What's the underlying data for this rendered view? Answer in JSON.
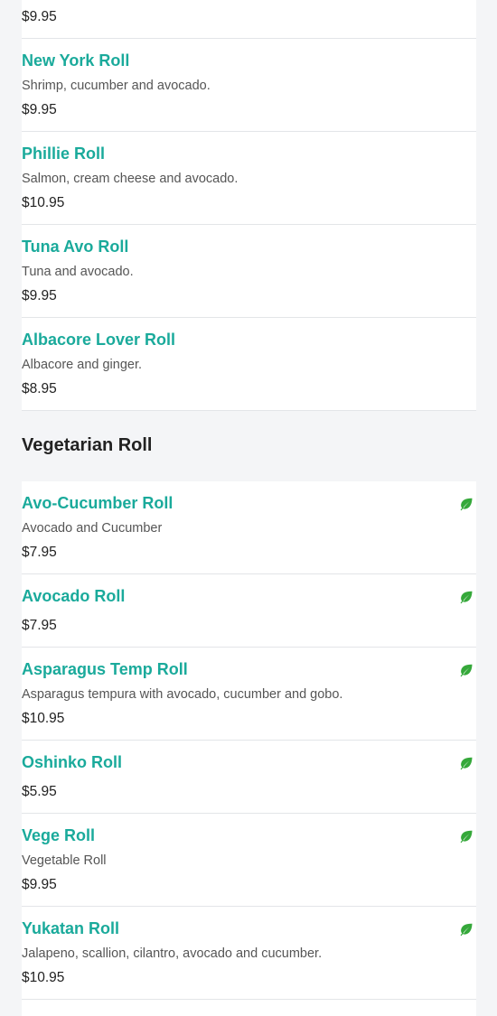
{
  "top_section": {
    "items": [
      {
        "name": "",
        "description": "",
        "price": "$9.95"
      },
      {
        "name": "New York Roll",
        "description": "Shrimp, cucumber and avocado.",
        "price": "$9.95"
      },
      {
        "name": "Phillie Roll",
        "description": "Salmon, cream cheese and avocado.",
        "price": "$10.95"
      },
      {
        "name": "Tuna Avo Roll",
        "description": "Tuna and avocado.",
        "price": "$9.95"
      },
      {
        "name": "Albacore Lover Roll",
        "description": "Albacore and ginger.",
        "price": "$8.95"
      }
    ]
  },
  "vegetarian_section": {
    "title": "Vegetarian Roll",
    "items": [
      {
        "name": "Avo-Cucumber Roll",
        "description": "Avocado and Cucumber",
        "price": "$7.95",
        "icon": "leaf-icon"
      },
      {
        "name": "Avocado Roll",
        "description": "",
        "price": "$7.95",
        "icon": "leaf-icon"
      },
      {
        "name": "Asparagus Temp Roll",
        "description": "Asparagus tempura with avocado, cucumber and gobo.",
        "price": "$10.95",
        "icon": "leaf-icon"
      },
      {
        "name": "Oshinko Roll",
        "description": "",
        "price": "$5.95",
        "icon": "leaf-icon"
      },
      {
        "name": "Vege Roll",
        "description": "Vegetable Roll",
        "price": "$9.95",
        "icon": "leaf-icon"
      },
      {
        "name": "Yukatan Roll",
        "description": "Jalapeno, scallion, cilantro, avocado and cucumber.",
        "price": "$10.95",
        "icon": "leaf-icon"
      }
    ]
  },
  "colors": {
    "item_name": "#1aaa9b",
    "leaf_icon": "#35a83a",
    "background": "#f4f5f7"
  }
}
